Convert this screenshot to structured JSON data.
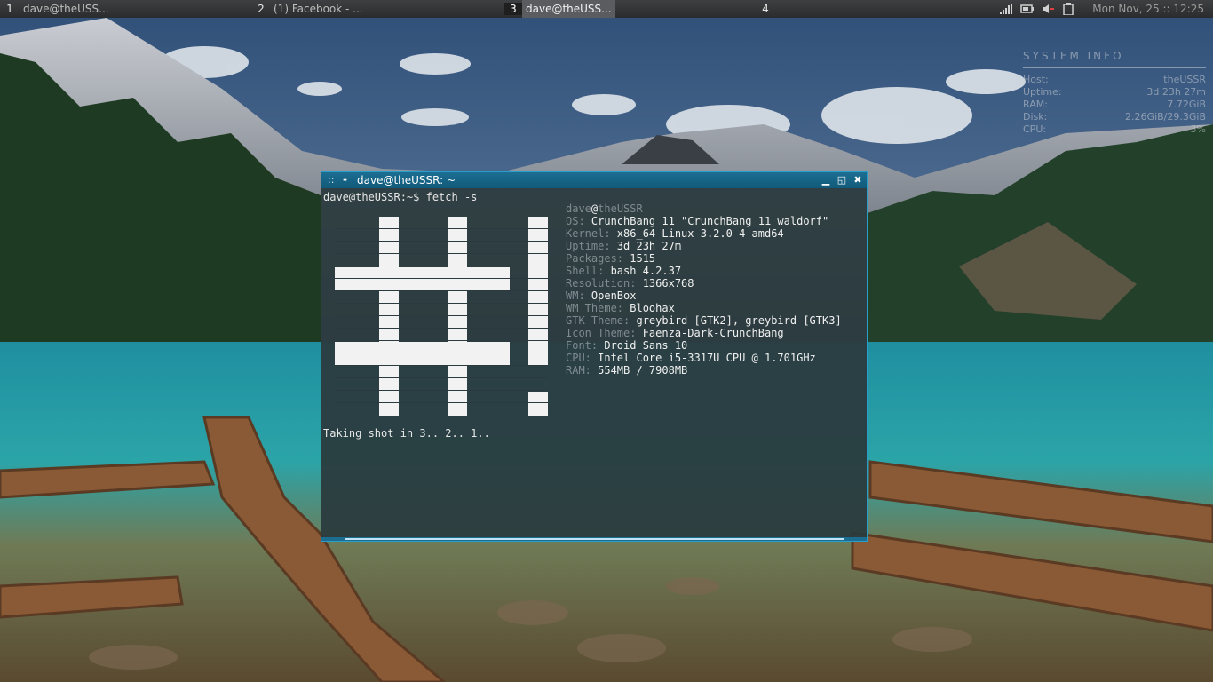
{
  "panel": {
    "workspaces": [
      {
        "num": "1",
        "task": "dave@theUSS..."
      },
      {
        "num": "2",
        "task": "(1) Facebook - ..."
      },
      {
        "num": "3",
        "task": "dave@theUSS..."
      },
      {
        "num": "4",
        "task": ""
      }
    ],
    "active_workspace": "3",
    "clock": "Mon Nov, 25 :: 12:25",
    "tray_icons": [
      "network-signal-icon",
      "battery-icon",
      "volume-muted-icon",
      "clipboard-icon"
    ]
  },
  "conky": {
    "title": "SYSTEM INFO",
    "rows": [
      {
        "label": "Host:",
        "value": "theUSSR"
      },
      {
        "label": "Uptime:",
        "value": "3d 23h 27m"
      },
      {
        "label": "RAM:",
        "value": "7.72GiB"
      },
      {
        "label": "Disk:",
        "value": "2.26GiB/29.3GiB"
      },
      {
        "label": "CPU:",
        "value": "3%"
      }
    ]
  },
  "window": {
    "title": "dave@theUSSR: ~",
    "colors": {
      "titlebar": "#1b6e92",
      "border": "#2a9ec8",
      "background": "#2a3a3e"
    }
  },
  "terminal": {
    "prompt_line": "dave@theUSSR:~$ fetch -s",
    "user": "dave",
    "at": "@",
    "host": "theUSSR",
    "info": [
      {
        "key": "OS:",
        "value": " CrunchBang 11 \"CrunchBang 11 waldorf\""
      },
      {
        "key": "Kernel:",
        "value": " x86_64 Linux 3.2.0-4-amd64"
      },
      {
        "key": "Uptime:",
        "value": " 3d 23h 27m"
      },
      {
        "key": "Packages:",
        "value": " 1515"
      },
      {
        "key": "Shell:",
        "value": " bash 4.2.37"
      },
      {
        "key": "Resolution:",
        "value": " 1366x768"
      },
      {
        "key": "WM:",
        "value": " OpenBox"
      },
      {
        "key": "WM Theme:",
        "value": " Bloohax"
      },
      {
        "key": "GTK Theme:",
        "value": " greybird [GTK2], greybird [GTK3]"
      },
      {
        "key": "Icon Theme:",
        "value": " Faenza-Dark-CrunchBang"
      },
      {
        "key": "Font:",
        "value": " Droid Sans 10"
      },
      {
        "key": "CPU:",
        "value": " Intel Core i5-3317U CPU @ 1.701GHz"
      },
      {
        "key": "RAM:",
        "value": " 554MB / 7908MB"
      }
    ],
    "shot_line": "Taking shot in 3.. 2.. 1.."
  }
}
